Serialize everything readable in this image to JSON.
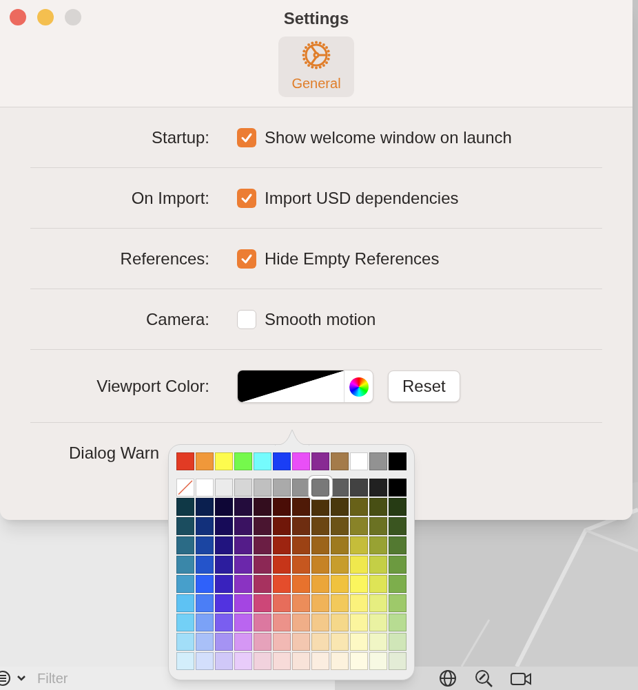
{
  "window": {
    "title": "Settings"
  },
  "tabs": [
    {
      "label": "General",
      "selected": true
    }
  ],
  "rows": [
    {
      "label": "Startup:",
      "kind": "checkbox",
      "text": "Show welcome window on launch",
      "checked": true
    },
    {
      "label": "On Import:",
      "kind": "checkbox",
      "text": "Import USD dependencies",
      "checked": true
    },
    {
      "label": "References:",
      "kind": "checkbox",
      "text": "Hide Empty References",
      "checked": true
    },
    {
      "label": "Camera:",
      "kind": "checkbox",
      "text": "Smooth motion",
      "checked": false
    },
    {
      "label": "Viewport Color:",
      "kind": "color",
      "button": "Reset"
    },
    {
      "label": "Dialog Warn",
      "kind": "partial"
    }
  ],
  "color_picker": {
    "rows": [
      {
        "swatches": [
          {
            "color": "#e23b24",
            "selected": false
          },
          {
            "color": "#f0983a",
            "selected": false
          },
          {
            "color": "#fdfb4e",
            "selected": false
          },
          {
            "color": "#75f94c",
            "selected": false
          },
          {
            "color": "#75fbfd",
            "selected": false
          },
          {
            "color": "#1a3ef5",
            "selected": false
          },
          {
            "color": "#e94ff7",
            "selected": false
          },
          {
            "color": "#882a93",
            "selected": false
          },
          {
            "color": "#a47b4a",
            "selected": false
          },
          {
            "color": "#ffffff",
            "selected": false
          },
          {
            "color": "#929292",
            "selected": false
          },
          {
            "color": "#000000",
            "selected": false
          }
        ]
      },
      {
        "swatches": [
          {
            "kind": "none",
            "selected": false
          },
          {
            "color": "#ffffff",
            "selected": false
          },
          {
            "color": "#ebebeb",
            "selected": false
          },
          {
            "color": "#d6d6d6",
            "selected": false
          },
          {
            "color": "#c0c0c0",
            "selected": false
          },
          {
            "color": "#aaaaaa",
            "selected": false
          },
          {
            "color": "#929292",
            "selected": false
          },
          {
            "color": "#797979",
            "selected": true
          },
          {
            "color": "#5e5e5e",
            "selected": false
          },
          {
            "color": "#424242",
            "selected": false
          },
          {
            "color": "#212121",
            "selected": false
          },
          {
            "color": "#000000",
            "selected": false
          }
        ]
      },
      {
        "swatches": [
          {
            "color": "#0f3846",
            "selected": false
          },
          {
            "color": "#0a1f4f",
            "selected": false
          },
          {
            "color": "#0e0636",
            "selected": false
          },
          {
            "color": "#230c3c",
            "selected": false
          },
          {
            "color": "#330d1e",
            "selected": false
          },
          {
            "color": "#4a0d06",
            "selected": false
          },
          {
            "color": "#4f1a07",
            "selected": false
          },
          {
            "color": "#4c320a",
            "selected": false
          },
          {
            "color": "#4a380d",
            "selected": false
          },
          {
            "color": "#686118",
            "selected": false
          },
          {
            "color": "#484f14",
            "selected": false
          },
          {
            "color": "#263b14",
            "selected": false
          }
        ]
      },
      {
        "swatches": [
          {
            "color": "#1b4d5f",
            "selected": false
          },
          {
            "color": "#12307b",
            "selected": false
          },
          {
            "color": "#170b58",
            "selected": false
          },
          {
            "color": "#3a1261",
            "selected": false
          },
          {
            "color": "#4a1530",
            "selected": false
          },
          {
            "color": "#701709",
            "selected": false
          },
          {
            "color": "#6e2d10",
            "selected": false
          },
          {
            "color": "#6b4612",
            "selected": false
          },
          {
            "color": "#6c5317",
            "selected": false
          },
          {
            "color": "#898328",
            "selected": false
          },
          {
            "color": "#6b7223",
            "selected": false
          },
          {
            "color": "#3a5520",
            "selected": false
          }
        ]
      },
      {
        "swatches": [
          {
            "color": "#2b6b86",
            "selected": false
          },
          {
            "color": "#1b45a2",
            "selected": false
          },
          {
            "color": "#21147f",
            "selected": false
          },
          {
            "color": "#541c89",
            "selected": false
          },
          {
            "color": "#6b1e44",
            "selected": false
          },
          {
            "color": "#9d2410",
            "selected": false
          },
          {
            "color": "#9c4214",
            "selected": false
          },
          {
            "color": "#9c6419",
            "selected": false
          },
          {
            "color": "#9e7a1f",
            "selected": false
          },
          {
            "color": "#c5bd3a",
            "selected": false
          },
          {
            "color": "#98a233",
            "selected": false
          },
          {
            "color": "#537931",
            "selected": false
          }
        ]
      },
      {
        "swatches": [
          {
            "color": "#3a87a9",
            "selected": false
          },
          {
            "color": "#2454cb",
            "selected": false
          },
          {
            "color": "#2c1d9e",
            "selected": false
          },
          {
            "color": "#6b27ab",
            "selected": false
          },
          {
            "color": "#8c2855",
            "selected": false
          },
          {
            "color": "#c63519",
            "selected": false
          },
          {
            "color": "#c6571f",
            "selected": false
          },
          {
            "color": "#c68325",
            "selected": false
          },
          {
            "color": "#c79d2c",
            "selected": false
          },
          {
            "color": "#f0e84d",
            "selected": false
          },
          {
            "color": "#c4cf46",
            "selected": false
          },
          {
            "color": "#6c9a40",
            "selected": false
          }
        ]
      },
      {
        "swatches": [
          {
            "color": "#479fcb",
            "selected": false
          },
          {
            "color": "#2f61fa",
            "selected": false
          },
          {
            "color": "#3922bd",
            "selected": false
          },
          {
            "color": "#8a33c2",
            "selected": false
          },
          {
            "color": "#a7325f",
            "selected": false
          },
          {
            "color": "#e44d2c",
            "selected": false
          },
          {
            "color": "#e7722d",
            "selected": false
          },
          {
            "color": "#eba63a",
            "selected": false
          },
          {
            "color": "#f0c23e",
            "selected": false
          },
          {
            "color": "#fbf55e",
            "selected": false
          },
          {
            "color": "#dee456",
            "selected": false
          },
          {
            "color": "#7dae4c",
            "selected": false
          }
        ]
      },
      {
        "swatches": [
          {
            "color": "#5ec2f3",
            "selected": false
          },
          {
            "color": "#4b7ef6",
            "selected": false
          },
          {
            "color": "#5233e0",
            "selected": false
          },
          {
            "color": "#a445e2",
            "selected": false
          },
          {
            "color": "#cd4778",
            "selected": false
          },
          {
            "color": "#e76d5b",
            "selected": false
          },
          {
            "color": "#ec8d5a",
            "selected": false
          },
          {
            "color": "#f0b359",
            "selected": false
          },
          {
            "color": "#f2c95b",
            "selected": false
          },
          {
            "color": "#fbf27c",
            "selected": false
          },
          {
            "color": "#e6ee80",
            "selected": false
          },
          {
            "color": "#9ec96a",
            "selected": false
          }
        ]
      },
      {
        "swatches": [
          {
            "color": "#73d0f6",
            "selected": false
          },
          {
            "color": "#7ba2f7",
            "selected": false
          },
          {
            "color": "#7a5ef0",
            "selected": false
          },
          {
            "color": "#ba65f0",
            "selected": false
          },
          {
            "color": "#dc78a0",
            "selected": false
          },
          {
            "color": "#ec928a",
            "selected": false
          },
          {
            "color": "#f0ae88",
            "selected": false
          },
          {
            "color": "#f4c98a",
            "selected": false
          },
          {
            "color": "#f5d88a",
            "selected": false
          },
          {
            "color": "#fbf59e",
            "selected": false
          },
          {
            "color": "#eaf2a2",
            "selected": false
          },
          {
            "color": "#b7dc92",
            "selected": false
          }
        ]
      },
      {
        "swatches": [
          {
            "color": "#a2def8",
            "selected": false
          },
          {
            "color": "#a9c0f8",
            "selected": false
          },
          {
            "color": "#a593f3",
            "selected": false
          },
          {
            "color": "#d597f4",
            "selected": false
          },
          {
            "color": "#e6a2bb",
            "selected": false
          },
          {
            "color": "#f2b9b4",
            "selected": false
          },
          {
            "color": "#f3c7b0",
            "selected": false
          },
          {
            "color": "#f7dcb0",
            "selected": false
          },
          {
            "color": "#f9e6b1",
            "selected": false
          },
          {
            "color": "#fdf9c4",
            "selected": false
          },
          {
            "color": "#f0f6c5",
            "selected": false
          },
          {
            "color": "#d0e6b8",
            "selected": false
          }
        ]
      },
      {
        "swatches": [
          {
            "color": "#d3eefb",
            "selected": false
          },
          {
            "color": "#d3dffc",
            "selected": false
          },
          {
            "color": "#d0c8f8",
            "selected": false
          },
          {
            "color": "#e8ccfa",
            "selected": false
          },
          {
            "color": "#f1d2dd",
            "selected": false
          },
          {
            "color": "#f7dbd9",
            "selected": false
          },
          {
            "color": "#f8e3d9",
            "selected": false
          },
          {
            "color": "#fbede0",
            "selected": false
          },
          {
            "color": "#fcf2dd",
            "selected": false
          },
          {
            "color": "#fefbe3",
            "selected": false
          },
          {
            "color": "#f7f9e3",
            "selected": false
          },
          {
            "color": "#e3ecd6",
            "selected": false
          }
        ]
      }
    ]
  },
  "background": {
    "filter": {
      "placeholder": "Filter"
    }
  }
}
